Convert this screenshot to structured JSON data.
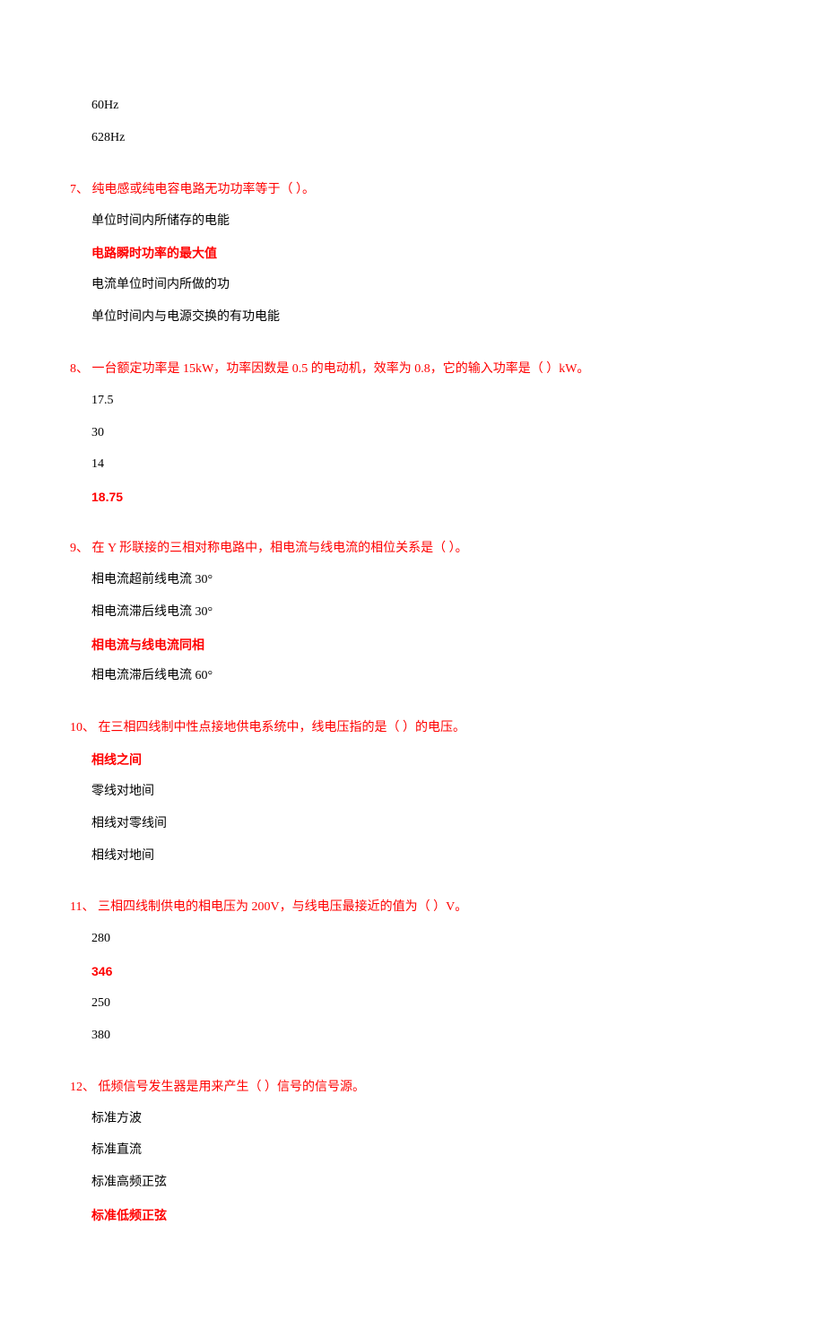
{
  "orphan": {
    "opts": [
      {
        "text": "60Hz",
        "correct": false
      },
      {
        "text": "628Hz",
        "correct": false
      }
    ]
  },
  "questions": [
    {
      "num": "7、",
      "stem": " 纯电感或纯电容电路无功功率等于（ ）。",
      "opts": [
        {
          "text": "单位时间内所储存的电能",
          "correct": false
        },
        {
          "text": "电路瞬时功率的最大值",
          "correct": true
        },
        {
          "text": "电流单位时间内所做的功",
          "correct": false
        },
        {
          "text": "单位时间内与电源交换的有功电能",
          "correct": false
        }
      ]
    },
    {
      "num": "8、",
      "stem": " 一台额定功率是 15kW，功率因数是 0.5 的电动机，效率为 0.8，它的输入功率是（ ）kW。",
      "opts": [
        {
          "text": "17.5",
          "correct": false
        },
        {
          "text": "30",
          "correct": false
        },
        {
          "text": "14",
          "correct": false
        },
        {
          "text": "18.75",
          "correct": true
        }
      ]
    },
    {
      "num": "9、",
      "stem": " 在 Y 形联接的三相对称电路中，相电流与线电流的相位关系是（ ）。",
      "opts": [
        {
          "text": "相电流超前线电流 30°",
          "correct": false
        },
        {
          "text": "相电流滞后线电流 30°",
          "correct": false
        },
        {
          "text": "相电流与线电流同相",
          "correct": true
        },
        {
          "text": "相电流滞后线电流 60°",
          "correct": false
        }
      ]
    },
    {
      "num": "10、",
      "stem": " 在三相四线制中性点接地供电系统中，线电压指的是（ ）的电压。",
      "opts": [
        {
          "text": "相线之间",
          "correct": true
        },
        {
          "text": "零线对地间",
          "correct": false
        },
        {
          "text": "相线对零线间",
          "correct": false
        },
        {
          "text": "相线对地间",
          "correct": false
        }
      ]
    },
    {
      "num": "11、",
      "stem": " 三相四线制供电的相电压为 200V，与线电压最接近的值为（ ）V。",
      "opts": [
        {
          "text": "280",
          "correct": false
        },
        {
          "text": "346",
          "correct": true
        },
        {
          "text": "250",
          "correct": false
        },
        {
          "text": "380",
          "correct": false
        }
      ]
    },
    {
      "num": "12、",
      "stem": " 低频信号发生器是用来产生（ ）信号的信号源。",
      "opts": [
        {
          "text": "标准方波",
          "correct": false
        },
        {
          "text": "标准直流",
          "correct": false
        },
        {
          "text": "标准高频正弦",
          "correct": false
        },
        {
          "text": "标准低频正弦",
          "correct": true
        }
      ]
    }
  ]
}
